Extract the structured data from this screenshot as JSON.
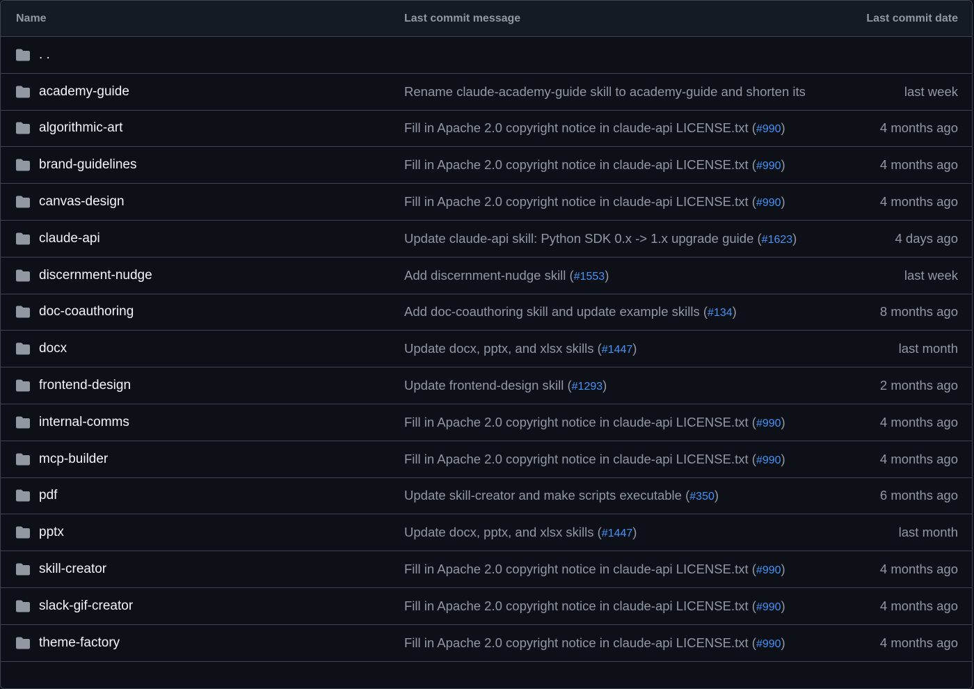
{
  "header": {
    "name": "Name",
    "message": "Last commit message",
    "date": "Last commit date"
  },
  "parent": {
    "name": ". ."
  },
  "rows": [
    {
      "name": "academy-guide",
      "msg": "Rename claude-academy-guide skill to academy-guide and shorten its de...",
      "pr": "",
      "date": "last week"
    },
    {
      "name": "algorithmic-art",
      "msg": "Fill in Apache 2.0 copyright notice in claude-api LICENSE.txt (",
      "pr": "#990",
      "date": "4 months ago"
    },
    {
      "name": "brand-guidelines",
      "msg": "Fill in Apache 2.0 copyright notice in claude-api LICENSE.txt (",
      "pr": "#990",
      "date": "4 months ago"
    },
    {
      "name": "canvas-design",
      "msg": "Fill in Apache 2.0 copyright notice in claude-api LICENSE.txt (",
      "pr": "#990",
      "date": "4 months ago"
    },
    {
      "name": "claude-api",
      "msg": "Update claude-api skill: Python SDK 0.x -> 1.x upgrade guide (",
      "pr": "#1623",
      "date": "4 days ago"
    },
    {
      "name": "discernment-nudge",
      "msg": "Add discernment-nudge skill (",
      "pr": "#1553",
      "date": "last week"
    },
    {
      "name": "doc-coauthoring",
      "msg": "Add doc-coauthoring skill and update example skills (",
      "pr": "#134",
      "date": "8 months ago"
    },
    {
      "name": "docx",
      "msg": "Update docx, pptx, and xlsx skills (",
      "pr": "#1447",
      "date": "last month"
    },
    {
      "name": "frontend-design",
      "msg": "Update frontend-design skill (",
      "pr": "#1293",
      "date": "2 months ago"
    },
    {
      "name": "internal-comms",
      "msg": "Fill in Apache 2.0 copyright notice in claude-api LICENSE.txt (",
      "pr": "#990",
      "date": "4 months ago"
    },
    {
      "name": "mcp-builder",
      "msg": "Fill in Apache 2.0 copyright notice in claude-api LICENSE.txt (",
      "pr": "#990",
      "date": "4 months ago"
    },
    {
      "name": "pdf",
      "msg": "Update skill-creator and make scripts executable (",
      "pr": "#350",
      "date": "6 months ago"
    },
    {
      "name": "pptx",
      "msg": "Update docx, pptx, and xlsx skills (",
      "pr": "#1447",
      "date": "last month"
    },
    {
      "name": "skill-creator",
      "msg": "Fill in Apache 2.0 copyright notice in claude-api LICENSE.txt (",
      "pr": "#990",
      "date": "4 months ago"
    },
    {
      "name": "slack-gif-creator",
      "msg": "Fill in Apache 2.0 copyright notice in claude-api LICENSE.txt (",
      "pr": "#990",
      "date": "4 months ago"
    },
    {
      "name": "theme-factory",
      "msg": "Fill in Apache 2.0 copyright notice in claude-api LICENSE.txt (",
      "pr": "#990",
      "date": "4 months ago"
    }
  ],
  "colors": {
    "background": "#0d1117",
    "header_bg": "#151b23",
    "border": "#3d444d",
    "text_primary": "#f0f6fc",
    "text_muted": "#9198a1",
    "link": "#4493f8",
    "folder_icon": "#9198a1"
  }
}
